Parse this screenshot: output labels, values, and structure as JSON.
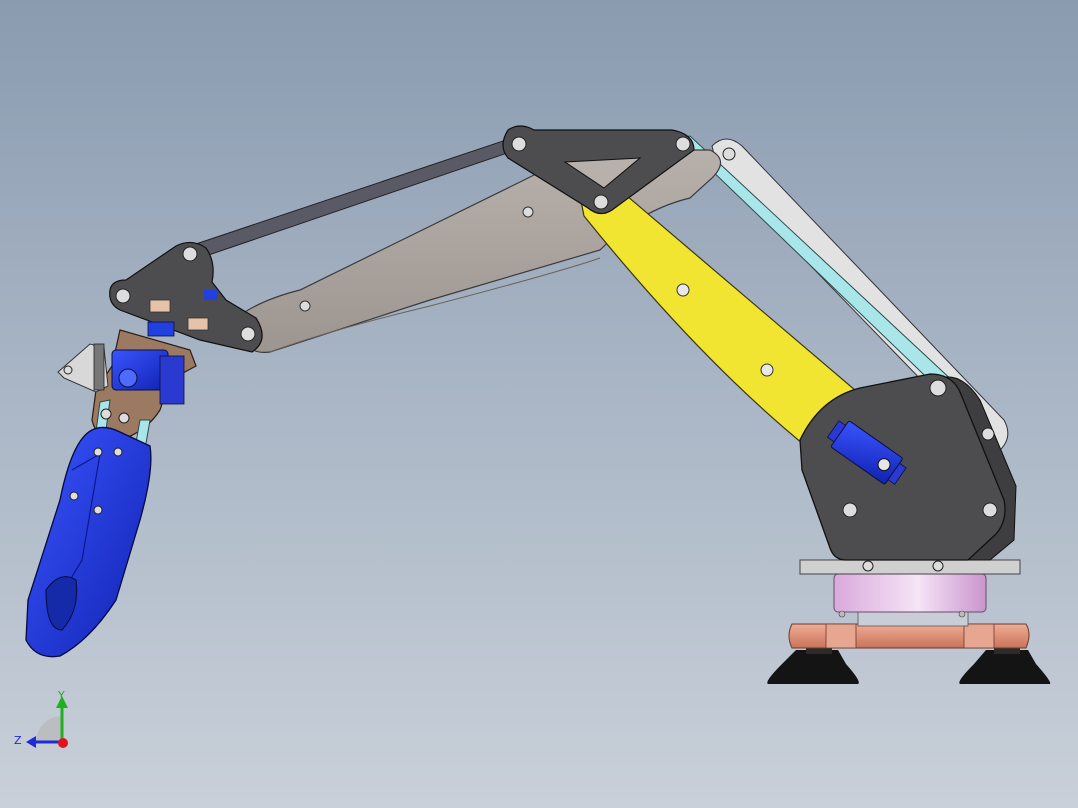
{
  "colors": {
    "background_top": "#8a9bb0",
    "background_bottom": "#c9d0d9",
    "upper_arm": "#a8a09a",
    "forearm_link": "#f2e531",
    "link_bar_dark": "#56555f",
    "link_bar_cyan": "#a9e6ea",
    "link_bar_white": "#e2e2e2",
    "bracket_dark": "#4d4d4f",
    "servo_blue": "#1d2fd6",
    "gripper_blue": "#2340d6",
    "wrist_brown": "#9c7a62",
    "turntable_pink": "#e7c8e8",
    "base_plate_copper": "#e0957b",
    "suction_cup_black": "#141414"
  },
  "triad": {
    "y_label": "Y",
    "z_label": "Z",
    "y_color": "#1fb01f",
    "z_color": "#1f2ad8",
    "x_color": "#e0141e"
  },
  "icons": [
    "screw-head-icon",
    "axis-triad-icon"
  ]
}
